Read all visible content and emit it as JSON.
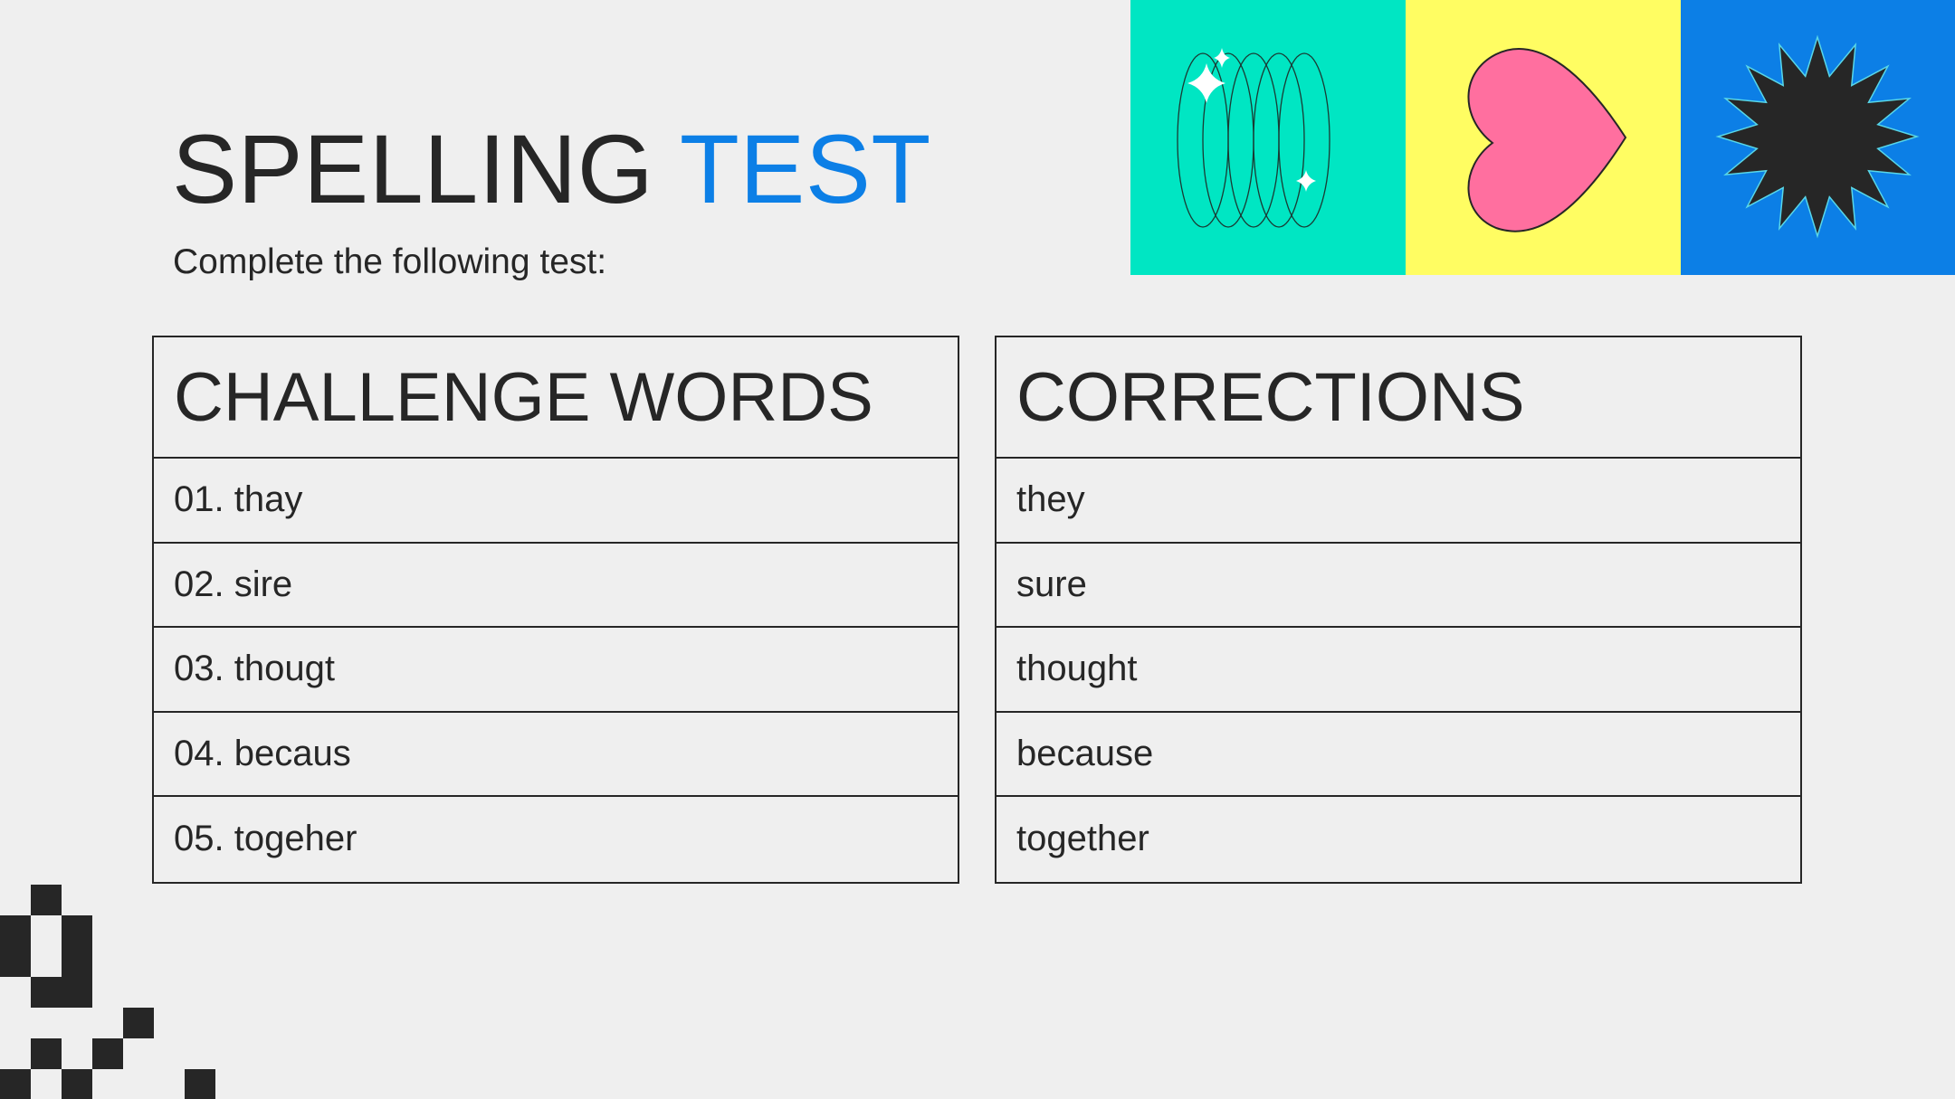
{
  "title": {
    "main": "SPELLING",
    "accent": "TEST"
  },
  "subtitle": "Complete the following test:",
  "challenge": {
    "header": "CHALLENGE WORDS",
    "items": [
      "01. thay",
      "02. sire",
      "03. thougt",
      "04. becaus",
      "05. togeher"
    ]
  },
  "corrections": {
    "header": "CORRECTIONS",
    "items": [
      "they",
      "sure",
      "thought",
      "because",
      "together"
    ]
  },
  "colors": {
    "accent": "#0c7fe6",
    "teal": "#00e6c3",
    "yellow": "#fffd62",
    "pink": "#ff6f9f",
    "text": "#262626",
    "background": "#efefef"
  },
  "decorations": [
    "rings-sparkle-icon",
    "heart-icon",
    "starburst-icon",
    "pixel-pattern"
  ]
}
